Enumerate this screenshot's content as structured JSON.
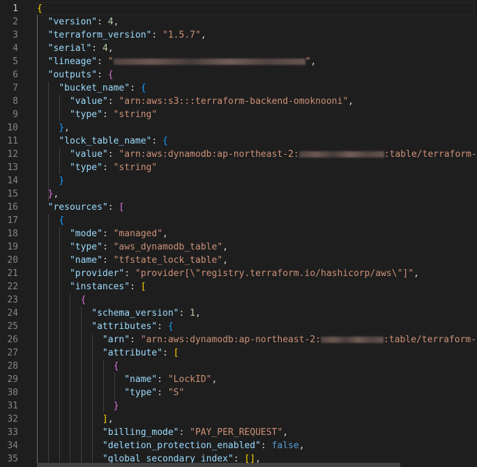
{
  "gutter": {
    "line_numbers": [
      "1",
      "2",
      "3",
      "4",
      "5",
      "6",
      "7",
      "8",
      "9",
      "10",
      "11",
      "12",
      "13",
      "14",
      "15",
      "16",
      "17",
      "18",
      "19",
      "20",
      "21",
      "22",
      "23",
      "24",
      "25",
      "26",
      "27",
      "28",
      "29",
      "30",
      "31",
      "32",
      "33",
      "34",
      "35"
    ],
    "active_line": "1"
  },
  "tokens": {
    "version_key": "\"version\"",
    "version_val": "4",
    "tfver_key": "\"terraform_version\"",
    "tfver_val": "\"1.5.7\"",
    "serial_key": "\"serial\"",
    "serial_val": "4",
    "lineage_key": "\"lineage\"",
    "lineage_open": "\"",
    "lineage_close": "\"",
    "outputs_key": "\"outputs\"",
    "bucket_name_key": "\"bucket_name\"",
    "value_key": "\"value\"",
    "bucket_value": "\"arn:aws:s3:::terraform-backend-omoknooni\"",
    "type_key": "\"type\"",
    "string_val": "\"string\"",
    "lock_table_name_key": "\"lock_table_name\"",
    "lock_value_prefix": "\"arn:aws:dynamodb:ap-northeast-2:",
    "lock_value_suffix": ":table/terraform-lock-",
    "resources_key": "\"resources\"",
    "mode_key": "\"mode\"",
    "mode_val": "\"managed\"",
    "res_type_val": "\"aws_dynamodb_table\"",
    "name_key": "\"name\"",
    "name_val": "\"tfstate_lock_table\"",
    "provider_key": "\"provider\"",
    "provider_val": "\"provider[\\\"registry.terraform.io/hashicorp/aws\\\"]\"",
    "instances_key": "\"instances\"",
    "schema_version_key": "\"schema_version\"",
    "schema_version_val": "1",
    "attributes_key": "\"attributes\"",
    "arn_key": "\"arn\"",
    "arn_prefix": "\"arn:aws:dynamodb:ap-northeast-2:",
    "arn_suffix": ":table/terraform-l",
    "attribute_key": "\"attribute\"",
    "lockid_val": "\"LockID\"",
    "s_val": "\"S\"",
    "billing_mode_key": "\"billing_mode\"",
    "billing_mode_val": "\"PAY_PER_REQUEST\"",
    "deletion_protection_key": "\"deletion_protection_enabled\"",
    "false_val": "false",
    "gsi_key": "\"global_secondary_index\""
  },
  "colors": {
    "background": "#1e1e1e",
    "key": "#9cdcfe",
    "string": "#ce9178",
    "number": "#b5cea8",
    "keyword": "#569cd6",
    "bracket_level_1": "#ffd700",
    "bracket_level_2": "#da70d6",
    "bracket_level_3": "#179fff",
    "line_number": "#858585"
  }
}
